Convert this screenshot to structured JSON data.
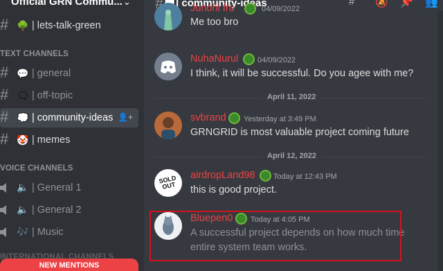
{
  "server": {
    "name": "Official GRN Commu..."
  },
  "sidebar": {
    "channels": [
      {
        "label": "| lets-talk-green",
        "emoji": "🌳"
      },
      {
        "label": "| general",
        "emoji": "💬"
      },
      {
        "label": "| off-topic",
        "emoji": "🗨"
      },
      {
        "label": "| community-ideas",
        "emoji": "💭"
      },
      {
        "label": "| memes",
        "emoji": "🤡"
      }
    ],
    "text_category": "TEXT CHANNELS",
    "voice_category": "VOICE CHANNELS",
    "voice": [
      {
        "label": "| General 1",
        "emoji": "🔈"
      },
      {
        "label": "| General 2",
        "emoji": "🔈"
      },
      {
        "label": "| Music",
        "emoji": "🎶"
      }
    ],
    "partial_category": "INTERNATIONAL CHANNELS",
    "mentions_label": "NEW MENTIONS"
  },
  "topbar": {
    "channel": "| community-ideas",
    "emoji": "💭"
  },
  "messages": [
    {
      "user": "Junohi fru",
      "time": "04/09/2022",
      "text": "Me too bro"
    },
    {
      "user": "NuhaNurul",
      "time": "04/09/2022",
      "text": "I think, it will be successful.  Do you agee with me?"
    },
    {
      "user": "svbrand",
      "time": "Yesterday at 3:49 PM",
      "text": "GRNGRID is most valuable project coming future"
    },
    {
      "user": "airdropLand98",
      "time": "Today at 12:43 PM",
      "text": "this is good project."
    },
    {
      "user": "Bluepen0",
      "time": "Today at 4:05 PM",
      "text_line1": "A successful project depends on how much time",
      "text_line2": "entire system team works."
    }
  ],
  "dividers": [
    "April 11, 2022",
    "April 12, 2022"
  ],
  "avatar_text": {
    "sold_out": "SOLD OUT"
  },
  "colors": {
    "username": "#ed4245",
    "highlight": "#d3121c",
    "mentions": "#ed4245",
    "badge": "#3b8a2a"
  }
}
